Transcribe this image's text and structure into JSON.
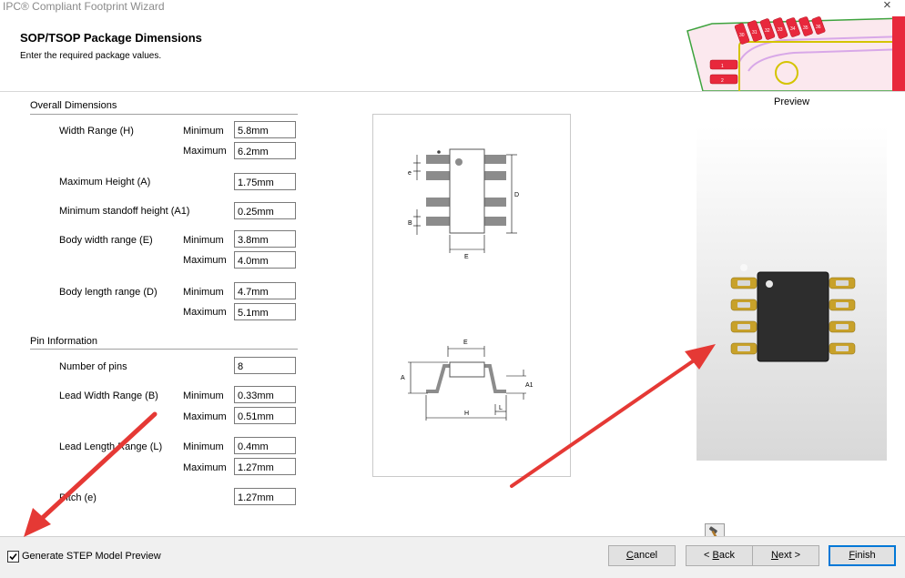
{
  "window": {
    "title": "IPC® Compliant Footprint Wizard",
    "close_glyph": "×"
  },
  "header": {
    "title": "SOP/TSOP Package Dimensions",
    "subtitle": "Enter the required package values."
  },
  "overall": {
    "label": "Overall Dimensions",
    "width_range": {
      "label": "Width Range (H)",
      "min_label": "Minimum",
      "max_label": "Maximum",
      "min": "5.8mm",
      "max": "6.2mm"
    },
    "max_height": {
      "label": "Maximum Height (A)",
      "value": "1.75mm"
    },
    "min_standoff": {
      "label": "Minimum standoff height (A1)",
      "value": "0.25mm"
    },
    "body_width": {
      "label": "Body width range (E)",
      "min_label": "Minimum",
      "max_label": "Maximum",
      "min": "3.8mm",
      "max": "4.0mm"
    },
    "body_length": {
      "label": "Body length range (D)",
      "min_label": "Minimum",
      "max_label": "Maximum",
      "min": "4.7mm",
      "max": "5.1mm"
    }
  },
  "pin": {
    "label": "Pin Information",
    "num_pins": {
      "label": "Number of pins",
      "value": "8"
    },
    "lead_width": {
      "label": "Lead Width Range (B)",
      "min_label": "Minimum",
      "max_label": "Maximum",
      "min": "0.33mm",
      "max": "0.51mm"
    },
    "lead_length": {
      "label": "Lead Length Range (L)",
      "min_label": "Minimum",
      "max_label": "Maximum",
      "min": "0.4mm",
      "max": "1.27mm"
    },
    "pitch": {
      "label": "Pitch (e)",
      "value": "1.27mm"
    }
  },
  "diagram": {
    "top_labels": {
      "e": "e",
      "B": "B",
      "D": "D",
      "E": "E"
    },
    "side_labels": {
      "E": "E",
      "A": "A",
      "A1": "A1",
      "H": "H",
      "L": "L"
    }
  },
  "banner": {
    "pad_labels": [
      "1",
      "2",
      "30",
      "31",
      "32",
      "33",
      "34",
      "35",
      "36"
    ]
  },
  "preview": {
    "label": "Preview",
    "tool_icon": "hammer-icon"
  },
  "footer": {
    "step_checkbox": {
      "label": "Generate STEP Model Preview",
      "checked": true
    },
    "buttons": {
      "cancel": "Cancel",
      "back": "< Back",
      "next": "Next >",
      "finish": "Finish"
    }
  },
  "colors": {
    "pad_gold": "#c8a12a",
    "chip_body": "#2d2d2d",
    "lead_grey": "#8c8c8c",
    "pcb_red": "#e8283c",
    "accent_blue": "#0078d7",
    "arrow_red": "#e53935"
  }
}
